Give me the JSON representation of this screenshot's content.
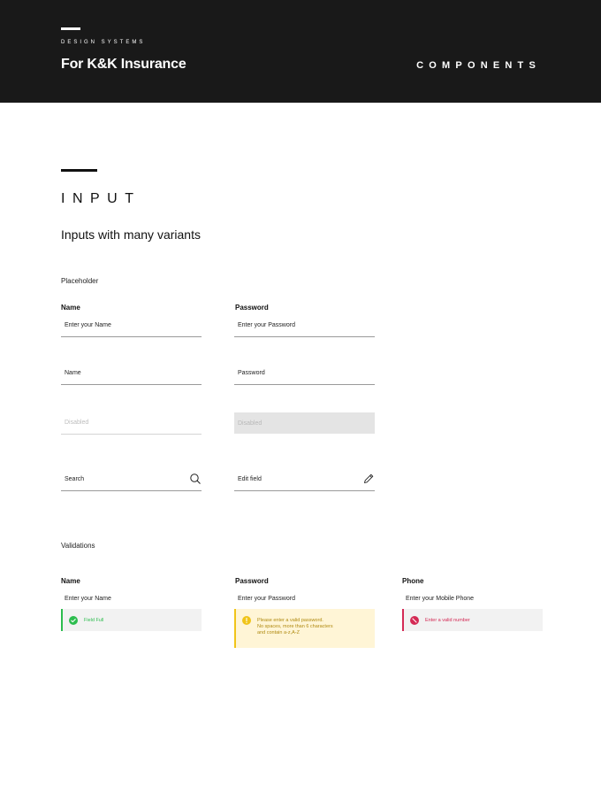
{
  "header": {
    "eyebrow": "DESIGN SYSTEMS",
    "brand": "For K&K Insurance",
    "section_label": "COMPONENTS"
  },
  "section": {
    "title": "INPUT",
    "subtitle": "Inputs with many variants"
  },
  "placeholder_group": {
    "label": "Placeholder",
    "name_label": "Name",
    "password_label": "Password",
    "name_placeholder": "Enter your Name",
    "password_placeholder": "Enter your Password",
    "name_plain": "Name",
    "password_plain": "Password",
    "disabled_text": "Disabled",
    "disabled_filled_text": "Disabled",
    "search_placeholder": "Search",
    "edit_placeholder": "Edit field",
    "search_icon": "search-icon",
    "edit_icon": "pencil-icon"
  },
  "validations_group": {
    "label": "Validations",
    "name_label": "Name",
    "password_label": "Password",
    "phone_label": "Phone",
    "name_placeholder": "Enter your Name",
    "password_placeholder": "Enter your Password",
    "phone_placeholder": "Enter your Mobile Phone",
    "success_msg": "Field Full",
    "warning_line1": "Please enter a valid password.",
    "warning_line2": "No spaces, more than 6 characters",
    "warning_line3": "and contain a-z,A-Z",
    "error_msg": "Enter a valid number"
  },
  "colors": {
    "header_bg": "#191919",
    "success": "#2dbd4f",
    "warning": "#f0c419",
    "error": "#d42a55"
  }
}
